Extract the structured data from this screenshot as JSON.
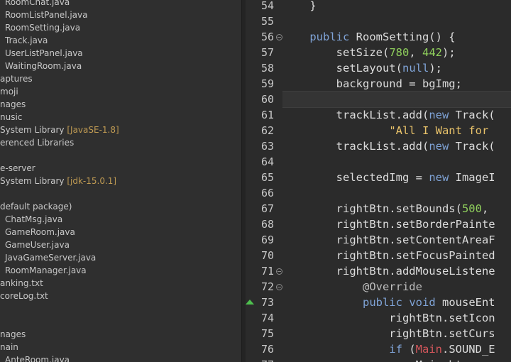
{
  "explorer": {
    "rows": [
      {
        "indent": 7,
        "icon": "java-file-icon",
        "label": "RoomChat.java"
      },
      {
        "indent": 7,
        "icon": "java-file-icon",
        "label": "RoomListPanel.java"
      },
      {
        "indent": 7,
        "icon": "java-file-icon",
        "label": "RoomSetting.java"
      },
      {
        "indent": 7,
        "icon": "java-file-icon",
        "label": "Track.java"
      },
      {
        "indent": 7,
        "icon": "java-file-icon",
        "label": "UserListPanel.java"
      },
      {
        "indent": 7,
        "icon": "java-file-icon",
        "label": "WaitingRoom.java"
      },
      {
        "indent": 0,
        "icon": "",
        "label": "aptures"
      },
      {
        "indent": 0,
        "icon": "",
        "label": "moji"
      },
      {
        "indent": 0,
        "icon": "",
        "label": "nages"
      },
      {
        "indent": 0,
        "icon": "",
        "label": "nusic"
      },
      {
        "indent": 0,
        "icon": "library-icon",
        "label": "System Library",
        "annot": "[JavaSE-1.8]"
      },
      {
        "indent": 0,
        "icon": "",
        "label": "erenced Libraries"
      },
      {
        "indent": 0,
        "icon": "",
        "label": ""
      },
      {
        "indent": 0,
        "icon": "",
        "label": "e-server"
      },
      {
        "indent": 0,
        "icon": "library-icon",
        "label": "System Library",
        "annot": "[jdk-15.0.1]"
      },
      {
        "indent": 0,
        "icon": "",
        "label": ""
      },
      {
        "indent": 0,
        "icon": "",
        "label": "default package)"
      },
      {
        "indent": 7,
        "icon": "java-file-icon",
        "label": "ChatMsg.java"
      },
      {
        "indent": 7,
        "icon": "java-file-icon",
        "label": "GameRoom.java"
      },
      {
        "indent": 7,
        "icon": "java-file-icon",
        "label": "GameUser.java"
      },
      {
        "indent": 7,
        "icon": "java-file-icon",
        "label": "JavaGameServer.java"
      },
      {
        "indent": 7,
        "icon": "java-file-icon",
        "label": "RoomManager.java"
      },
      {
        "indent": 0,
        "icon": "",
        "label": "anking.txt"
      },
      {
        "indent": 0,
        "icon": "",
        "label": "coreLog.txt"
      },
      {
        "indent": 0,
        "icon": "",
        "label": ""
      },
      {
        "indent": 0,
        "icon": "",
        "label": ""
      },
      {
        "indent": 0,
        "icon": "",
        "label": "nages"
      },
      {
        "indent": 0,
        "icon": "",
        "label": "nain"
      },
      {
        "indent": 7,
        "icon": "java-file-icon",
        "label": "AnteRoom.java"
      }
    ]
  },
  "editor": {
    "lines": [
      {
        "num": "54",
        "fold": false,
        "marker": false,
        "tokens": [
          [
            "    }",
            "plain"
          ]
        ]
      },
      {
        "num": "55",
        "fold": false,
        "marker": false,
        "tokens": []
      },
      {
        "num": "56",
        "fold": true,
        "marker": false,
        "tokens": [
          [
            "    ",
            "plain"
          ],
          [
            "public",
            "kw"
          ],
          [
            " RoomSetting() {",
            "plain"
          ]
        ]
      },
      {
        "num": "57",
        "fold": false,
        "marker": false,
        "tokens": [
          [
            "        setSize(",
            "plain"
          ],
          [
            "780",
            "num"
          ],
          [
            ", ",
            "plain"
          ],
          [
            "442",
            "num"
          ],
          [
            ");",
            "plain"
          ]
        ]
      },
      {
        "num": "58",
        "fold": false,
        "marker": false,
        "tokens": [
          [
            "        setLayout(",
            "plain"
          ],
          [
            "null",
            "kw"
          ],
          [
            ");",
            "plain"
          ]
        ]
      },
      {
        "num": "59",
        "fold": false,
        "marker": false,
        "tokens": [
          [
            "        background = bgImg;",
            "plain"
          ]
        ]
      },
      {
        "num": "60",
        "fold": false,
        "marker": false,
        "tokens": []
      },
      {
        "num": "61",
        "fold": false,
        "marker": false,
        "tokens": [
          [
            "        trackList.add(",
            "plain"
          ],
          [
            "new",
            "kw"
          ],
          [
            " Track(",
            "plain"
          ]
        ]
      },
      {
        "num": "62",
        "fold": false,
        "marker": false,
        "tokens": [
          [
            "                ",
            "plain"
          ],
          [
            "\"All I Want for",
            "str"
          ]
        ]
      },
      {
        "num": "63",
        "fold": false,
        "marker": false,
        "tokens": [
          [
            "        trackList.add(",
            "plain"
          ],
          [
            "new",
            "kw"
          ],
          [
            " Track(",
            "plain"
          ]
        ]
      },
      {
        "num": "64",
        "fold": false,
        "marker": false,
        "tokens": []
      },
      {
        "num": "65",
        "fold": false,
        "marker": false,
        "tokens": [
          [
            "        selectedImg = ",
            "plain"
          ],
          [
            "new",
            "kw"
          ],
          [
            " ImageI",
            "plain"
          ]
        ]
      },
      {
        "num": "66",
        "fold": false,
        "marker": false,
        "tokens": []
      },
      {
        "num": "67",
        "fold": false,
        "marker": false,
        "tokens": [
          [
            "        rightBtn.setBounds(",
            "plain"
          ],
          [
            "500",
            "num"
          ],
          [
            ",",
            "plain"
          ]
        ]
      },
      {
        "num": "68",
        "fold": false,
        "marker": false,
        "tokens": [
          [
            "        rightBtn.setBorderPainte",
            "plain"
          ]
        ]
      },
      {
        "num": "69",
        "fold": false,
        "marker": false,
        "tokens": [
          [
            "        rightBtn.setContentAreaF",
            "plain"
          ]
        ]
      },
      {
        "num": "70",
        "fold": false,
        "marker": false,
        "tokens": [
          [
            "        rightBtn.setFocusPainted",
            "plain"
          ]
        ]
      },
      {
        "num": "71",
        "fold": true,
        "marker": false,
        "tokens": [
          [
            "        rightBtn.addMouseListene",
            "plain"
          ]
        ]
      },
      {
        "num": "72",
        "fold": true,
        "marker": false,
        "tokens": [
          [
            "            ",
            "plain"
          ],
          [
            "@Override",
            "ann"
          ]
        ]
      },
      {
        "num": "73",
        "fold": false,
        "marker": true,
        "tokens": [
          [
            "            ",
            "plain"
          ],
          [
            "public",
            "kw"
          ],
          [
            " ",
            "plain"
          ],
          [
            "void",
            "kw"
          ],
          [
            " mouseEnt",
            "plain"
          ]
        ]
      },
      {
        "num": "74",
        "fold": false,
        "marker": false,
        "tokens": [
          [
            "                rightBtn.setIcon",
            "plain"
          ]
        ]
      },
      {
        "num": "75",
        "fold": false,
        "marker": false,
        "tokens": [
          [
            "                rightBtn.setCurs",
            "plain"
          ]
        ]
      },
      {
        "num": "76",
        "fold": false,
        "marker": false,
        "tokens": [
          [
            "                ",
            "plain"
          ],
          [
            "if",
            "kw"
          ],
          [
            " (",
            "plain"
          ],
          [
            "Main",
            "cls"
          ],
          [
            ".SOUND_E",
            "plain"
          ]
        ]
      },
      {
        "num": "77",
        "fold": false,
        "marker": false,
        "tokens": [
          [
            "                    Main.bt",
            "plain"
          ]
        ]
      }
    ]
  }
}
